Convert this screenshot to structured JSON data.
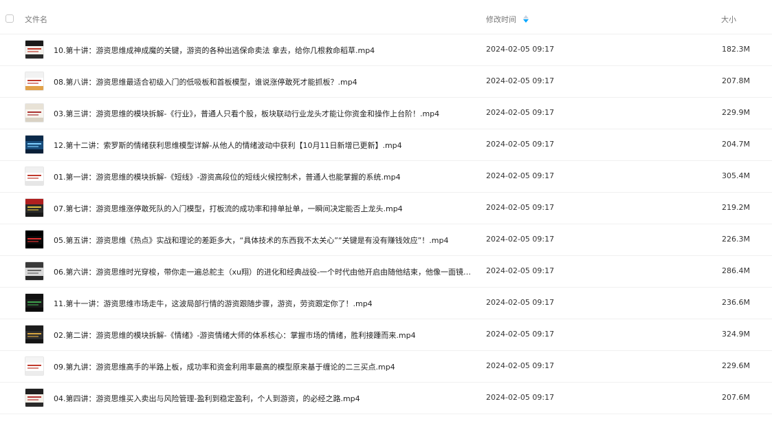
{
  "header": {
    "name_label": "文件名",
    "time_label": "修改时间",
    "size_label": "大小",
    "sort_colors": {
      "active": "#06a7ff",
      "inactive": "#c8d3e0"
    }
  },
  "files": [
    {
      "name": "10.第十讲：游资思维成神成魔的关键，游资的各种出逃保命卖法 拿去，给你几根救命稻草.mp4",
      "time": "2024-02-05 09:17",
      "size": "182.3M",
      "thumb": {
        "top": "#1a1a1a",
        "body": "#f3f1ec",
        "bottom": "#2b2b2b",
        "accent": "#c0392b"
      }
    },
    {
      "name": "08.第八讲：游资思维最适合初级入门的低吸板和首板模型，谁说涨停敢死才能抓板？.mp4",
      "time": "2024-02-05 09:17",
      "size": "207.8M",
      "thumb": {
        "top": "#f2f2f2",
        "body": "#ffffff",
        "bottom": "#e2a24a",
        "accent": "#c0392b"
      }
    },
    {
      "name": "03.第三讲：游资思维的模块拆解-《行业》，普通人只看个股，板块联动行业龙头才能让你资金和操作上台阶！.mp4",
      "time": "2024-02-05 09:17",
      "size": "229.9M",
      "thumb": {
        "top": "#e8e2d6",
        "body": "#f7f4ee",
        "bottom": "#d9d2c4",
        "accent": "#a33"
      }
    },
    {
      "name": "12.第十二讲：索罗斯的情绪获利思维模型详解-从他人的情绪波动中获利【10月11日新增已更新】.mp4",
      "time": "2024-02-05 09:17",
      "size": "204.7M",
      "thumb": {
        "top": "#0b2a4a",
        "body": "#184c7a",
        "bottom": "#0a1f38",
        "accent": "#7fd0ff"
      }
    },
    {
      "name": "01.第一讲：游资思维的模块拆解-《短线》-游资高段位的短线火候控制术，普通人也能掌握的系统.mp4",
      "time": "2024-02-05 09:17",
      "size": "305.4M",
      "thumb": {
        "top": "#f0f0f0",
        "body": "#ffffff",
        "bottom": "#e6e6e6",
        "accent": "#c0392b"
      }
    },
    {
      "name": "07.第七讲：游资思维涨停敢死队的入门模型，打板流的成功率和排单扯单，一瞬间决定能否上龙头.mp4",
      "time": "2024-02-05 09:17",
      "size": "219.2M",
      "thumb": {
        "top": "#b02020",
        "body": "#2a2a2a",
        "bottom": "#1a1a1a",
        "accent": "#e0c040"
      }
    },
    {
      "name": "05.第五讲：游资思维《热点》实战和理论的差距多大，“具体技术的东西我不太关心”“关键是有没有赚钱效应”！.mp4",
      "time": "2024-02-05 09:17",
      "size": "226.3M",
      "thumb": {
        "top": "#000000",
        "body": "#0a0a0a",
        "bottom": "#000000",
        "accent": "#e03030"
      }
    },
    {
      "name": "06.第六讲：游资思维时光穿梭，带你走一遍总舵主（xu翔）的进化和经典战役-一个时代由他开启由随他结束，他像一面镜子...",
      "time": "2024-02-05 09:17",
      "size": "286.4M",
      "thumb": {
        "top": "#3a3a3a",
        "body": "#d8d8d8",
        "bottom": "#2a2a2a",
        "accent": "#666"
      }
    },
    {
      "name": "11.第十一讲：游资思维市场走牛，这波局部行情的游资跟随步骤，游资，劳资跟定你了！.mp4",
      "time": "2024-02-05 09:17",
      "size": "236.6M",
      "thumb": {
        "top": "#111111",
        "body": "#1b1b1b",
        "bottom": "#0d0d0d",
        "accent": "#3fa34d"
      }
    },
    {
      "name": "02.第二讲：游资思维的模块拆解-《情绪》-游资情绪大师的体系核心：掌握市场的情绪，胜利接踵而来.mp4",
      "time": "2024-02-05 09:17",
      "size": "324.9M",
      "thumb": {
        "top": "#1c1c1c",
        "body": "#2d2d2d",
        "bottom": "#141414",
        "accent": "#d9a640"
      }
    },
    {
      "name": "09.第九讲：游资思维高手的半路上板，成功率和资金利用率最高的模型原来基于缠论的二三买点.mp4",
      "time": "2024-02-05 09:17",
      "size": "229.6M",
      "thumb": {
        "top": "#f4f4f4",
        "body": "#ffffff",
        "bottom": "#ececec",
        "accent": "#c0392b"
      }
    },
    {
      "name": "04.第四讲：游资思维买入卖出与风险管理-盈利到稳定盈利，个人到游资，的必经之路.mp4",
      "time": "2024-02-05 09:17",
      "size": "207.6M",
      "thumb": {
        "top": "#202020",
        "body": "#f4f0e8",
        "bottom": "#2a2a2a",
        "accent": "#b03030"
      }
    }
  ]
}
